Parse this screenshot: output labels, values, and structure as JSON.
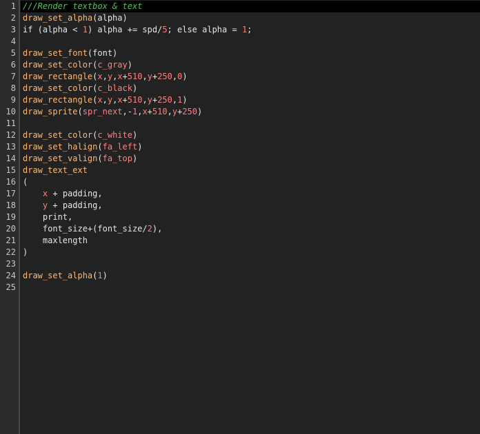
{
  "gutter": {
    "line_numbers": [
      "1",
      "2",
      "3",
      "4",
      "5",
      "6",
      "7",
      "8",
      "9",
      "10",
      "11",
      "12",
      "13",
      "14",
      "15",
      "16",
      "17",
      "18",
      "19",
      "20",
      "21",
      "22",
      "23",
      "24",
      "25"
    ]
  },
  "colors": {
    "background": "#222222",
    "gutter": "#2b2b2b",
    "function": "#ffb871",
    "number": "#ff8080",
    "comment": "#5bbf5b",
    "text": "#e6e6e6"
  },
  "lines": [
    [
      {
        "t": "comment",
        "v": "///Render textbox & text"
      }
    ],
    [
      {
        "t": "fn",
        "v": "draw_set_alpha"
      },
      {
        "t": "plain",
        "v": "(alpha)"
      }
    ],
    [
      {
        "t": "kw",
        "v": "if"
      },
      {
        "t": "plain",
        "v": " (alpha < "
      },
      {
        "t": "num",
        "v": "1"
      },
      {
        "t": "plain",
        "v": ") alpha += spd/"
      },
      {
        "t": "num",
        "v": "5"
      },
      {
        "t": "plain",
        "v": "; "
      },
      {
        "t": "kw",
        "v": "else"
      },
      {
        "t": "plain",
        "v": " alpha = "
      },
      {
        "t": "num",
        "v": "1"
      },
      {
        "t": "plain",
        "v": ";"
      }
    ],
    [],
    [
      {
        "t": "fn",
        "v": "draw_set_font"
      },
      {
        "t": "plain",
        "v": "(font)"
      }
    ],
    [
      {
        "t": "fn",
        "v": "draw_set_color"
      },
      {
        "t": "plain",
        "v": "("
      },
      {
        "t": "const",
        "v": "c_gray"
      },
      {
        "t": "plain",
        "v": ")"
      }
    ],
    [
      {
        "t": "fn",
        "v": "draw_rectangle"
      },
      {
        "t": "plain",
        "v": "("
      },
      {
        "t": "var",
        "v": "x"
      },
      {
        "t": "plain",
        "v": ","
      },
      {
        "t": "var",
        "v": "y"
      },
      {
        "t": "plain",
        "v": ","
      },
      {
        "t": "var",
        "v": "x"
      },
      {
        "t": "plain",
        "v": "+"
      },
      {
        "t": "num",
        "v": "510"
      },
      {
        "t": "plain",
        "v": ","
      },
      {
        "t": "var",
        "v": "y"
      },
      {
        "t": "plain",
        "v": "+"
      },
      {
        "t": "num",
        "v": "250"
      },
      {
        "t": "plain",
        "v": ","
      },
      {
        "t": "num",
        "v": "0"
      },
      {
        "t": "plain",
        "v": ")"
      }
    ],
    [
      {
        "t": "fn",
        "v": "draw_set_color"
      },
      {
        "t": "plain",
        "v": "("
      },
      {
        "t": "const",
        "v": "c_black"
      },
      {
        "t": "plain",
        "v": ")"
      }
    ],
    [
      {
        "t": "fn",
        "v": "draw_rectangle"
      },
      {
        "t": "plain",
        "v": "("
      },
      {
        "t": "var",
        "v": "x"
      },
      {
        "t": "plain",
        "v": ","
      },
      {
        "t": "var",
        "v": "y"
      },
      {
        "t": "plain",
        "v": ","
      },
      {
        "t": "var",
        "v": "x"
      },
      {
        "t": "plain",
        "v": "+"
      },
      {
        "t": "num",
        "v": "510"
      },
      {
        "t": "plain",
        "v": ","
      },
      {
        "t": "var",
        "v": "y"
      },
      {
        "t": "plain",
        "v": "+"
      },
      {
        "t": "num",
        "v": "250"
      },
      {
        "t": "plain",
        "v": ","
      },
      {
        "t": "num",
        "v": "1"
      },
      {
        "t": "plain",
        "v": ")"
      }
    ],
    [
      {
        "t": "fn",
        "v": "draw_sprite"
      },
      {
        "t": "plain",
        "v": "("
      },
      {
        "t": "const",
        "v": "spr_next"
      },
      {
        "t": "plain",
        "v": ",-"
      },
      {
        "t": "num",
        "v": "1"
      },
      {
        "t": "plain",
        "v": ","
      },
      {
        "t": "var",
        "v": "x"
      },
      {
        "t": "plain",
        "v": "+"
      },
      {
        "t": "num",
        "v": "510"
      },
      {
        "t": "plain",
        "v": ","
      },
      {
        "t": "var",
        "v": "y"
      },
      {
        "t": "plain",
        "v": "+"
      },
      {
        "t": "num",
        "v": "250"
      },
      {
        "t": "plain",
        "v": ")"
      }
    ],
    [],
    [
      {
        "t": "fn",
        "v": "draw_set_color"
      },
      {
        "t": "plain",
        "v": "("
      },
      {
        "t": "const",
        "v": "c_white"
      },
      {
        "t": "plain",
        "v": ")"
      }
    ],
    [
      {
        "t": "fn",
        "v": "draw_set_halign"
      },
      {
        "t": "plain",
        "v": "("
      },
      {
        "t": "const",
        "v": "fa_left"
      },
      {
        "t": "plain",
        "v": ")"
      }
    ],
    [
      {
        "t": "fn",
        "v": "draw_set_valign"
      },
      {
        "t": "plain",
        "v": "("
      },
      {
        "t": "const",
        "v": "fa_top"
      },
      {
        "t": "plain",
        "v": ")"
      }
    ],
    [
      {
        "t": "fn",
        "v": "draw_text_ext"
      }
    ],
    [
      {
        "t": "plain",
        "v": "("
      }
    ],
    [
      {
        "t": "plain",
        "v": "    "
      },
      {
        "t": "var",
        "v": "x"
      },
      {
        "t": "plain",
        "v": " + padding,"
      }
    ],
    [
      {
        "t": "plain",
        "v": "    "
      },
      {
        "t": "var",
        "v": "y"
      },
      {
        "t": "plain",
        "v": " + padding,"
      }
    ],
    [
      {
        "t": "plain",
        "v": "    print,"
      }
    ],
    [
      {
        "t": "plain",
        "v": "    font_size+(font_size/"
      },
      {
        "t": "num",
        "v": "2"
      },
      {
        "t": "plain",
        "v": "),"
      }
    ],
    [
      {
        "t": "plain",
        "v": "    maxlength"
      }
    ],
    [
      {
        "t": "plain",
        "v": ")"
      }
    ],
    [],
    [
      {
        "t": "fn",
        "v": "draw_set_alpha"
      },
      {
        "t": "plain",
        "v": "("
      },
      {
        "t": "num",
        "v": "1"
      },
      {
        "t": "plain",
        "v": ")"
      }
    ],
    []
  ]
}
